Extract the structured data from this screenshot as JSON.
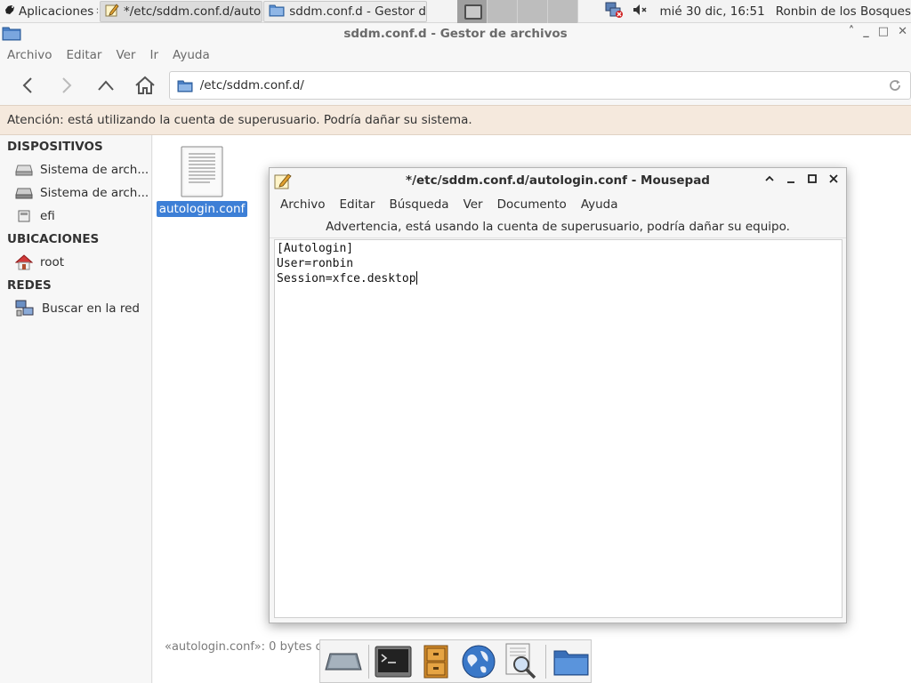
{
  "panel": {
    "apps_label": "Aplicaciones",
    "apps_separator": "∷",
    "tasks": [
      {
        "label": "*/etc/sddm.conf.d/autol..."
      },
      {
        "label": "sddm.conf.d - Gestor de..."
      }
    ],
    "clock": "mié 30 dic, 16:51",
    "user": "Ronbin de los Bosques"
  },
  "file_manager": {
    "title": "sddm.conf.d - Gestor de archivos",
    "window_buttons": {
      "shade": "˄",
      "minimize": "_",
      "maximize": "□",
      "close": "✕"
    },
    "menu": [
      "Archivo",
      "Editar",
      "Ver",
      "Ir",
      "Ayuda"
    ],
    "location": "/etc/sddm.conf.d/",
    "warning": "Atención: está utilizando la cuenta de superusuario. Podría dañar su sistema.",
    "sidebar": {
      "devices_header": "DISPOSITIVOS",
      "devices": [
        "Sistema de arch...",
        "Sistema de arch...",
        "efi"
      ],
      "places_header": "UBICACIONES",
      "places": [
        "root"
      ],
      "network_header": "REDES",
      "network": [
        "Buscar en la red"
      ]
    },
    "file_name": "autologin.conf",
    "status": "«autologin.conf»: 0 bytes c"
  },
  "mousepad": {
    "title": "*/etc/sddm.conf.d/autologin.conf - Mousepad",
    "menu": [
      "Archivo",
      "Editar",
      "Búsqueda",
      "Ver",
      "Documento",
      "Ayuda"
    ],
    "warning": "Advertencia, está usando la cuenta de superusuario, podría dañar su equipo.",
    "lines": [
      "[Autologin]",
      "User=ronbin",
      "Session=xfce.desktop"
    ]
  },
  "dock": {
    "items": [
      "show-desktop-icon",
      "terminal-icon",
      "file-cabinet-icon",
      "web-browser-icon",
      "app-finder-icon",
      "folder-icon"
    ]
  },
  "colors": {
    "selection": "#3d7fd6",
    "warning_bg": "#f5e9dd",
    "home_red": "#d23a3a"
  }
}
